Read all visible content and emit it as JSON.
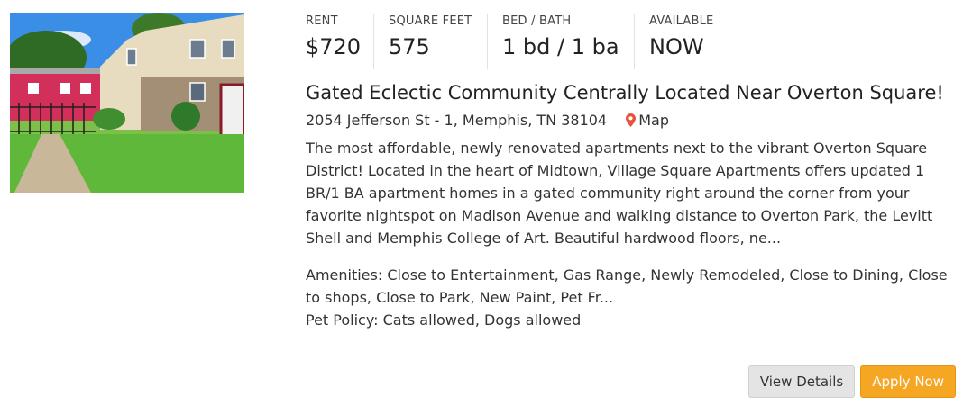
{
  "listing": {
    "photo_alt": "apartment-building-photo",
    "stats": [
      {
        "label": "RENT",
        "value": "$720"
      },
      {
        "label": "SQUARE FEET",
        "value": "575"
      },
      {
        "label": "BED / BATH",
        "value": "1 bd / 1 ba"
      },
      {
        "label": "AVAILABLE",
        "value": "NOW"
      }
    ],
    "title": "Gated Eclectic Community Centrally Located Near Overton Square!",
    "address": "2054 Jefferson St - 1, Memphis, TN 38104",
    "map_label": "Map",
    "map_icon": "map-pin-icon",
    "description": "The most affordable, newly renovated apartments next to the vibrant Overton Square District! Located in the heart of Midtown, Village Square Apartments offers updated 1 BR/1 BA apartment homes in a gated community right around the corner from your favorite nightspot on Madison Avenue and walking distance to Overton Park, the Levitt Shell and Memphis College of Art. Beautiful hardwood floors, ne...",
    "amenities": "Amenities: Close to Entertainment, Gas Range, Newly Remodeled, Close to Dining, Close to shops, Close to Park, New Paint, Pet Fr...",
    "pet_policy": "Pet Policy: Cats allowed, Dogs allowed"
  },
  "actions": {
    "view_details": "View Details",
    "apply_now": "Apply Now"
  },
  "colors": {
    "apply_button": "#f5a623",
    "details_button": "#e4e4e4",
    "map_pin": "#e8533f"
  }
}
